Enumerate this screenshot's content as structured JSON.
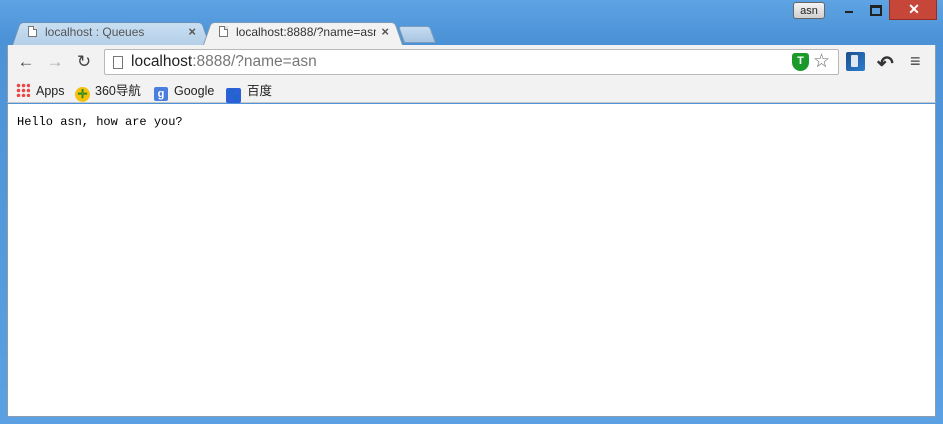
{
  "window": {
    "user_badge": "asn",
    "buttons": {
      "minimize_icon": "minimize-icon",
      "maximize_icon": "maximize-icon",
      "close_icon": "close-icon",
      "close_glyph": "✕"
    }
  },
  "tabs": [
    {
      "title": "localhost : Queues",
      "close": "×",
      "active": false
    },
    {
      "title": "localhost:8888/?name=asn",
      "close": "×",
      "active": true
    }
  ],
  "toolbar": {
    "back": "←",
    "forward": "→",
    "reload": "↻",
    "url_host": "localhost",
    "url_rest": ":8888/?name=asn",
    "shield_letter": "T",
    "star": "☆",
    "ext2": "↶",
    "menu": "≡"
  },
  "bookmarks": [
    {
      "label": "Apps",
      "icon": "apps-icon"
    },
    {
      "label": "360导航",
      "icon": "360-icon"
    },
    {
      "label": "Google",
      "icon": "google-icon",
      "glyph": "g"
    },
    {
      "label": "百度",
      "icon": "baidu-icon",
      "glyph": "🐾"
    }
  ],
  "page": {
    "body_text": "Hello asn, how are you?"
  },
  "colors": {
    "frame": "#4b92d6",
    "close_button": "#c7463a",
    "shield": "#1b9a2c"
  }
}
